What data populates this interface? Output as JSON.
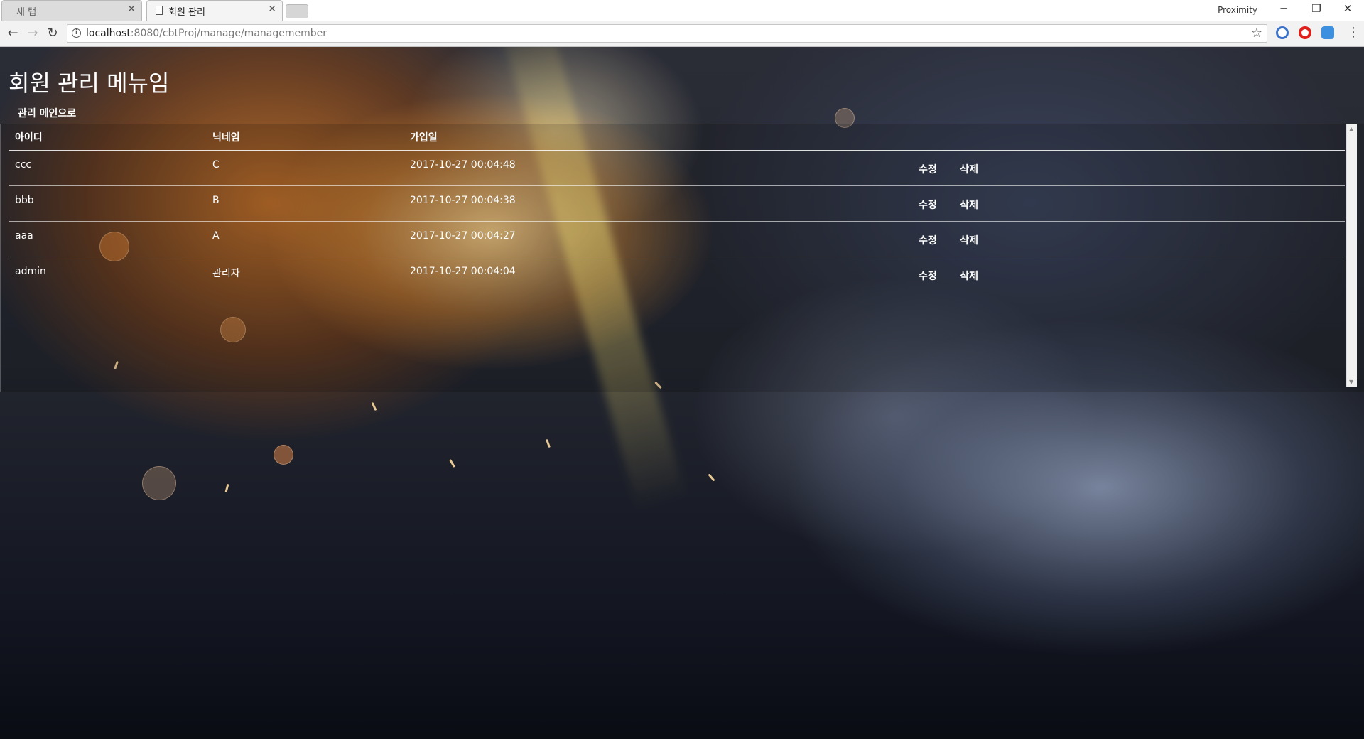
{
  "browser": {
    "tabs": [
      {
        "title": "새 탭",
        "active": false
      },
      {
        "title": "회원 관리",
        "active": true
      }
    ],
    "profile_name": "Proximity",
    "url_host": "localhost",
    "url_rest": ":8080/cbtProj/manage/managemember",
    "icons": {
      "back": "back-arrow-icon",
      "forward": "forward-arrow-icon",
      "reload": "reload-icon",
      "info": "info-icon",
      "bookmark": "star-icon",
      "menu": "menu-dots-icon"
    }
  },
  "page": {
    "title": "회원 관리 메뉴임",
    "back_link": "관리 메인으로"
  },
  "table": {
    "headers": {
      "id": "아이디",
      "nickname": "닉네임",
      "joined": "가입일"
    },
    "rows": [
      {
        "id": "ccc",
        "nickname": "C",
        "joined": "2017-10-27 00:04:48",
        "edit": "수정",
        "delete": "삭제"
      },
      {
        "id": "bbb",
        "nickname": "B",
        "joined": "2017-10-27 00:04:38",
        "edit": "수정",
        "delete": "삭제"
      },
      {
        "id": "aaa",
        "nickname": "A",
        "joined": "2017-10-27 00:04:27",
        "edit": "수정",
        "delete": "삭제"
      },
      {
        "id": "admin",
        "nickname": "관리자",
        "joined": "2017-10-27 00:04:04",
        "edit": "수정",
        "delete": "삭제"
      }
    ]
  }
}
